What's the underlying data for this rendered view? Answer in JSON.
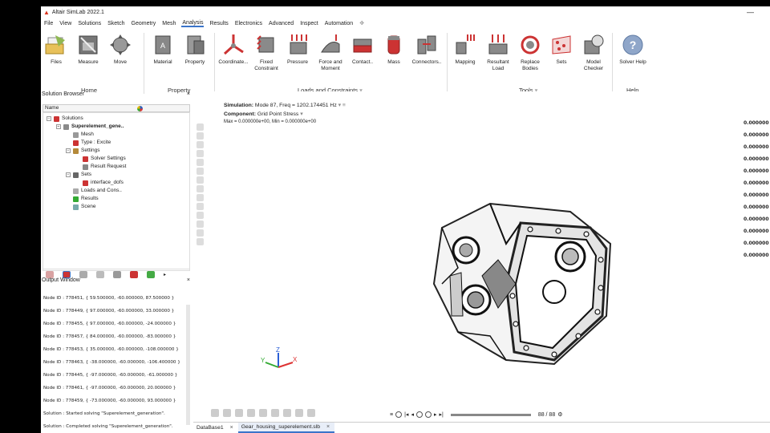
{
  "app": {
    "title": "Altair SimLab 2022.1"
  },
  "menu": [
    "File",
    "View",
    "Solutions",
    "Sketch",
    "Geometry",
    "Mesh",
    "Analysis",
    "Results",
    "Electronics",
    "Advanced",
    "Inspect",
    "Automation"
  ],
  "menu_active": "Analysis",
  "ribbon": {
    "home": {
      "label": "Home",
      "buttons": [
        "Files",
        "Measure",
        "Move"
      ]
    },
    "property": {
      "label": "Property",
      "buttons": [
        "Material",
        "Property"
      ]
    },
    "loads": {
      "label": "Loads and Constraints",
      "buttons": [
        "Coordinate...",
        "Fixed\nConstraint",
        "Pressure",
        "Force and\nMoment",
        "Contact..",
        "Mass",
        "Connectors.."
      ]
    },
    "tools": {
      "label": "Tools",
      "buttons": [
        "Mapping",
        "Resultant\nLoad",
        "Replace\nBodies",
        "Sets",
        "Model\nChecker"
      ]
    },
    "help": {
      "label": "Help",
      "buttons": [
        "Solver Help"
      ]
    }
  },
  "solution_browser": {
    "title": "Solution Browser",
    "col_name": "Name",
    "tree": [
      {
        "label": "Solutions",
        "level": 0,
        "toggle": "−",
        "icon": "solutions-icon",
        "bold": false
      },
      {
        "label": "Superelement_gene..",
        "level": 1,
        "toggle": "−",
        "icon": "superelement-icon",
        "bold": true
      },
      {
        "label": "Mesh",
        "level": 2,
        "toggle": "",
        "icon": "mesh-icon",
        "bold": false
      },
      {
        "label": "Type : Excite",
        "level": 2,
        "toggle": "",
        "icon": "type-icon",
        "bold": false
      },
      {
        "label": "Settings",
        "level": 2,
        "toggle": "−",
        "icon": "settings-icon",
        "bold": false
      },
      {
        "label": "Solver Settings",
        "level": 3,
        "toggle": "",
        "icon": "solver-settings-icon",
        "bold": false
      },
      {
        "label": "Result Request",
        "level": 3,
        "toggle": "",
        "icon": "result-request-icon",
        "bold": false
      },
      {
        "label": "Sets",
        "level": 2,
        "toggle": "−",
        "icon": "sets-icon",
        "bold": false
      },
      {
        "label": "interface_dofs",
        "level": 3,
        "toggle": "",
        "icon": "dof-set-icon",
        "bold": false
      },
      {
        "label": "Loads and Cons..",
        "level": 2,
        "toggle": "",
        "icon": "loads-icon",
        "bold": false
      },
      {
        "label": "Results",
        "level": 2,
        "toggle": "",
        "icon": "results-icon",
        "bold": false
      },
      {
        "label": "Scene",
        "level": 2,
        "toggle": "",
        "icon": "scene-icon",
        "bold": false
      }
    ]
  },
  "output_window": {
    "title": "Output Window",
    "lines": [
      "Node ID : 778451, { 59.500000, -60.000000, 87.500000 }",
      "Node ID : 778449, { 97.000000, -60.000000, 33.000000 }",
      "Node ID : 778455, { 97.000000, -60.000000, -24.000000 }",
      "Node ID : 778457, { 84.000000, -60.000000, -83.000000 }",
      "Node ID : 778453, { 35.000000, -60.000000, -108.000000 }",
      "Node ID : 778463, { -38.000000, -60.000000, -106.400000 }",
      "Node ID : 778445, { -97.000000, -60.000000, -61.000000 }",
      "Node ID : 778461, { -97.000000, -60.000000, 20.000000 }",
      "Node ID : 778459, { -73.000000, -60.000000, 93.000000 }",
      "Solution : Started solving \"Superelement_generation\".",
      "Solution : Completed solving \"Superelement_generation\"."
    ]
  },
  "viewport": {
    "simulation_label": "Simulation:",
    "simulation_value": "Mode 87, Freq = 1202.174451 Hz",
    "component_label": "Component:",
    "component_value": "Grid Point Stress",
    "minmax": "Max = 0.000000e+00, Min = 0.000000e+00",
    "legend_values": [
      "0.000000",
      "0.000000",
      "0.000000",
      "0.000000",
      "0.000000",
      "0.000000",
      "0.000000",
      "0.000000",
      "0.000000",
      "0.000000",
      "0.000000",
      "0.000000"
    ],
    "axes": {
      "x": "X",
      "y": "Y",
      "z": "Z"
    },
    "frame": "88 / 88"
  },
  "doc_tabs": [
    "DataBase1",
    "Gear_housing_superelement.slb"
  ],
  "colors": {
    "accent": "#3b74c9",
    "brand": "#d9331c"
  }
}
